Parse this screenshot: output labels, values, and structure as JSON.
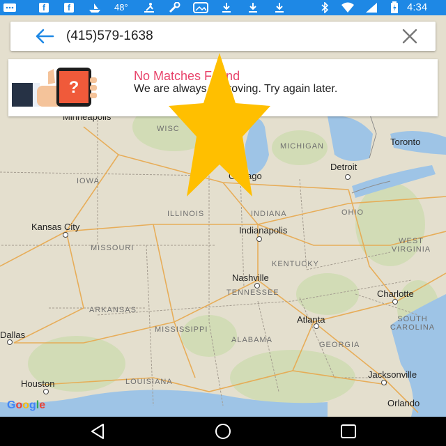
{
  "status_bar": {
    "temperature": "48°",
    "time": "4:34",
    "icons": [
      "message-icon",
      "facebook-icon",
      "facebook-icon",
      "boat-icon",
      "rowing-icon",
      "wrench-icon",
      "gallery-icon",
      "download-icon",
      "download-icon",
      "download-icon",
      "bluetooth-icon",
      "wifi-icon",
      "signal-icon",
      "battery-icon"
    ]
  },
  "search": {
    "value": "(415)579-1638"
  },
  "result_card": {
    "title": "No Matches Found",
    "message": "We are always improving. Try again later."
  },
  "map": {
    "watermark": "Google",
    "state_labels": [
      {
        "name": "WISCONSIN",
        "text": "WISC"
      },
      {
        "name": "MICHIGAN",
        "text": "MICHIGAN"
      },
      {
        "name": "IOWA",
        "text": "IOWA"
      },
      {
        "name": "ILLINOIS",
        "text": "ILLINOIS"
      },
      {
        "name": "INDIANA",
        "text": "INDIANA"
      },
      {
        "name": "OHIO",
        "text": "OHIO"
      },
      {
        "name": "MISSOURI",
        "text": "MISSOURI"
      },
      {
        "name": "KENTUCKY",
        "text": "KENTUCKY"
      },
      {
        "name": "WEST VIRGINIA",
        "text": "WEST VIRGINIA"
      },
      {
        "name": "TENNESSEE",
        "text": "TENNESSEE"
      },
      {
        "name": "ARKANSAS",
        "text": "ARKANSAS"
      },
      {
        "name": "MISSISSIPPI",
        "text": "MISSISSIPPI"
      },
      {
        "name": "ALABAMA",
        "text": "ALABAMA"
      },
      {
        "name": "GEORGIA",
        "text": "GEORGIA"
      },
      {
        "name": "SOUTH CAROLINA",
        "text": "SOUTH CAROLINA"
      },
      {
        "name": "LOUISIANA",
        "text": "LOUISIANA"
      }
    ],
    "city_labels": [
      "Minneapolis",
      "Toronto",
      "Detroit",
      "Chicago",
      "Kansas City",
      "Indianapolis",
      "Nashville",
      "Charlotte",
      "Atlanta",
      "Dallas",
      "Houston",
      "Jacksonville",
      "Orlando"
    ]
  },
  "colors": {
    "status_bar": "#1e88e5",
    "accent_blue": "#1e88e5",
    "error_pink": "#e8436a",
    "star_yellow": "#ffbf00",
    "nav_bar": "#000000"
  }
}
